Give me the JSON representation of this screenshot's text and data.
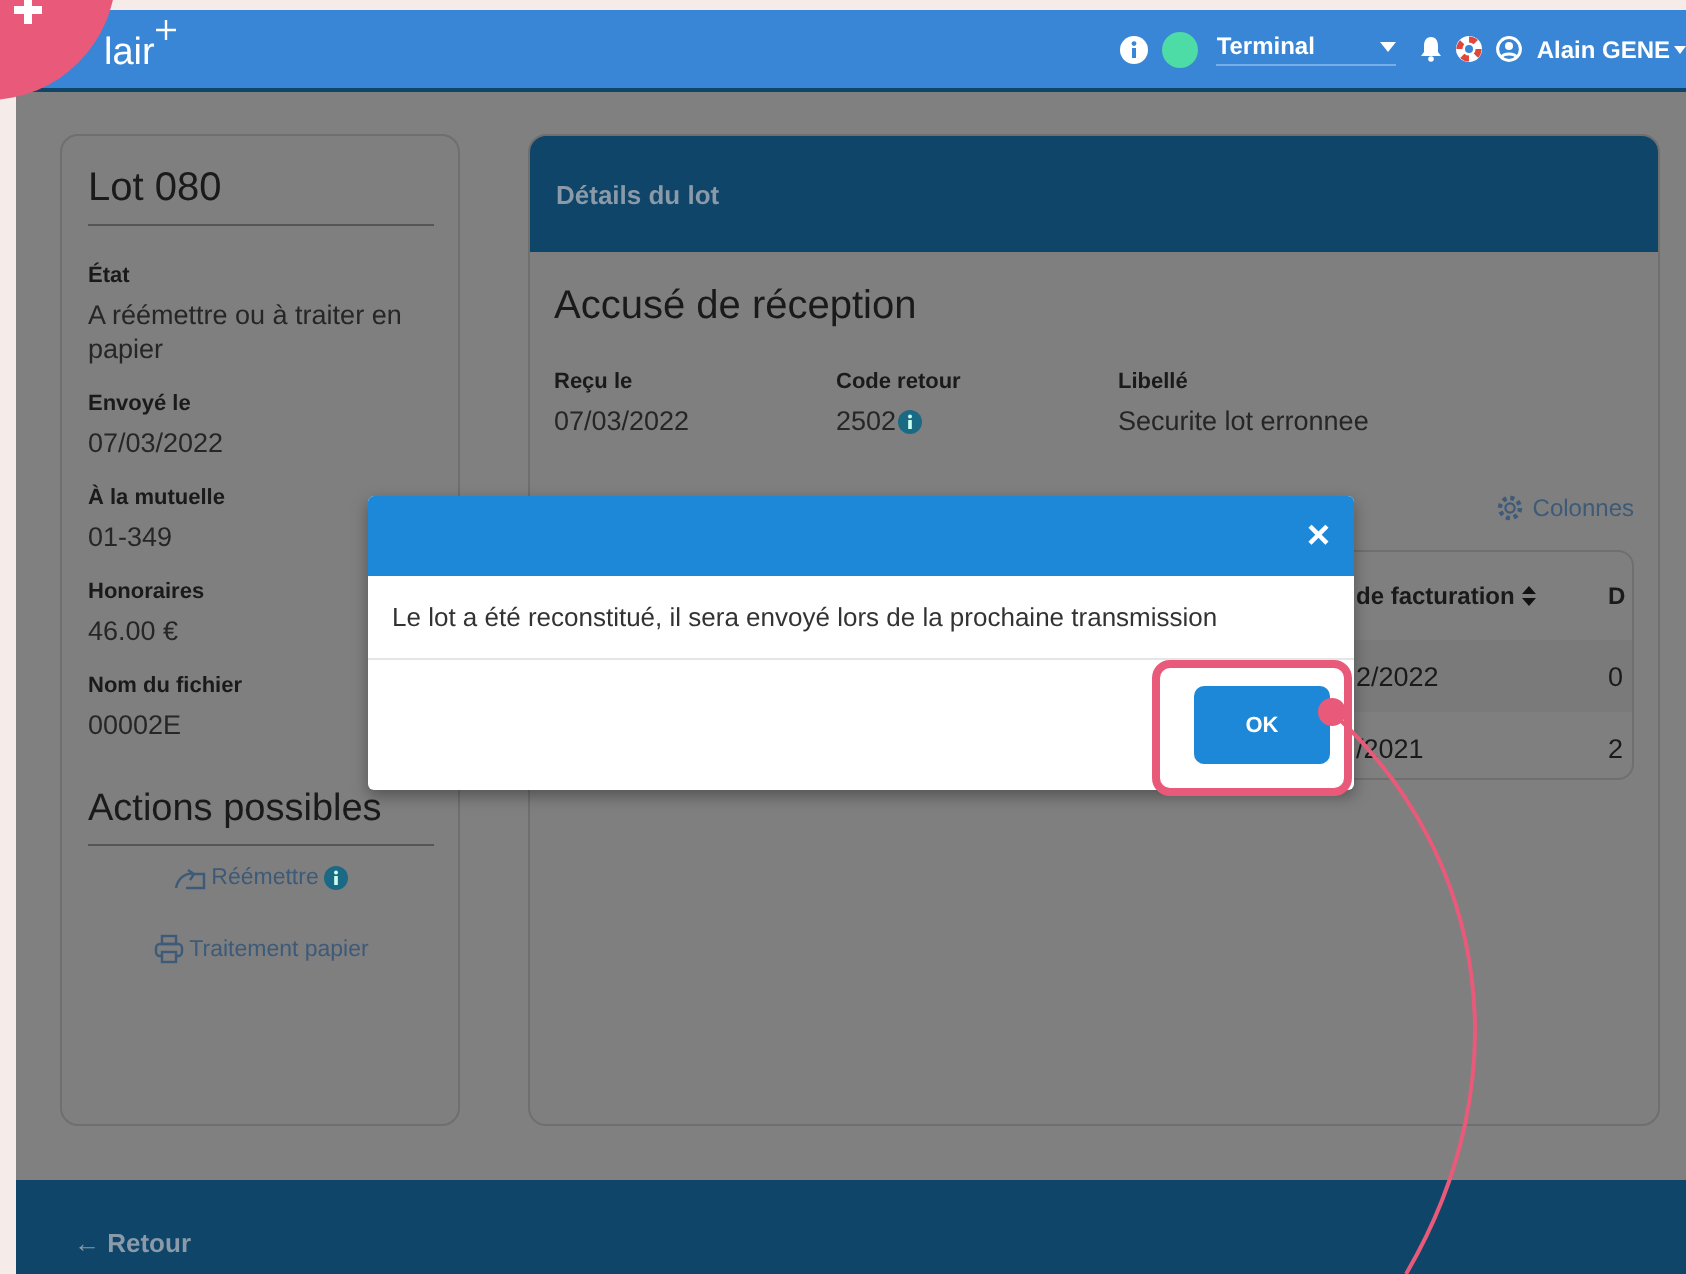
{
  "header": {
    "logo": "lair",
    "terminal": "Terminal",
    "user": "Alain GENE"
  },
  "lot": {
    "title": "Lot 080",
    "fields": [
      {
        "label": "État",
        "value": "A réémettre ou à traiter en papier"
      },
      {
        "label": "Envoyé le",
        "value": "07/03/2022"
      },
      {
        "label": "À la mutuelle",
        "value": "01-349"
      },
      {
        "label": "Honoraires",
        "value": "46.00 €"
      },
      {
        "label": "Nom du fichier",
        "value": "00002E"
      }
    ],
    "actions_title": "Actions possibles",
    "actions": [
      {
        "kind": "reissue",
        "label": "Réémettre",
        "info": true
      },
      {
        "kind": "print",
        "label": "Traitement papier",
        "info": false
      }
    ]
  },
  "details": {
    "title": "Détails du lot",
    "section": "Accusé de réception",
    "fields": [
      {
        "label": "Reçu le",
        "value": "07/03/2022",
        "info": false
      },
      {
        "label": "Code retour",
        "value": "2502",
        "info": true
      },
      {
        "label": "Libellé",
        "value": "Securite lot erronnee",
        "info": false
      }
    ],
    "columns_button": "Colonnes",
    "table": {
      "columns": [
        "de facturation",
        "D"
      ],
      "rows": [
        [
          "2/2022",
          "0"
        ],
        [
          "/2021",
          "2"
        ]
      ]
    }
  },
  "dialog": {
    "message": "Le lot a été reconstitué, il sera envoyé lors de la prochaine transmission",
    "close": "×",
    "button": "OK"
  },
  "footer": {
    "back": "← Retour"
  }
}
